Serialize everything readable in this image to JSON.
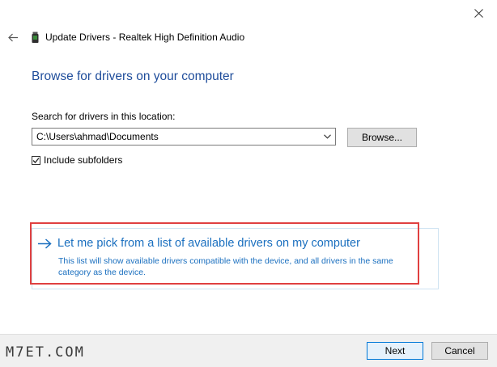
{
  "window": {
    "title": "Update Drivers - Realtek High Definition Audio"
  },
  "main": {
    "heading": "Browse for drivers on your computer",
    "search_label": "Search for drivers in this location:",
    "path_value": "C:\\Users\\ahmad\\Documents",
    "browse_label": "Browse...",
    "include_subfolders_label": "Include subfolders",
    "include_subfolders_checked": true
  },
  "option": {
    "title": "Let me pick from a list of available drivers on my computer",
    "description": "This list will show available drivers compatible with the device, and all drivers in the same category as the device."
  },
  "footer": {
    "watermark": "M7ET.COM",
    "next_label": "Next",
    "cancel_label": "Cancel"
  },
  "colors": {
    "heading": "#1f4d9b",
    "link": "#1a6fbf",
    "highlight": "#e04040",
    "default_button_border": "#0078d7"
  },
  "icons": {
    "close": "close-icon",
    "back": "back-arrow-icon",
    "device": "device-icon",
    "combo": "chevron-down-icon",
    "option_arrow": "arrow-right-icon",
    "checkbox": "checkmark-icon"
  }
}
